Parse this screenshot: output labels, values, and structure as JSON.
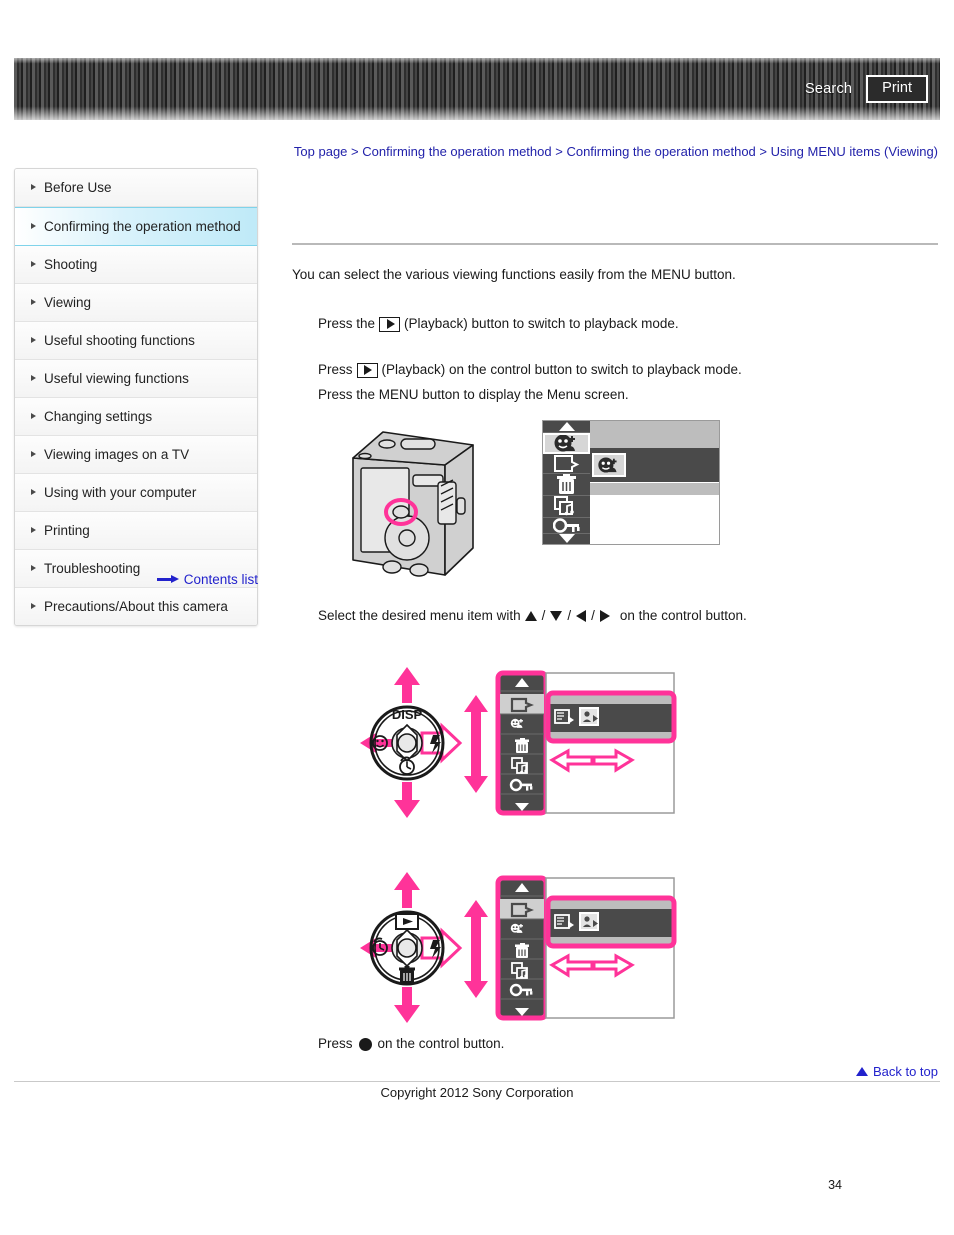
{
  "header": {
    "search_label": "Search",
    "print_label": "Print"
  },
  "breadcrumb": {
    "items": [
      "Top page",
      "Confirming the operation method",
      "Confirming the operation method",
      "Using MENU items (Viewing)"
    ],
    "separator": ">"
  },
  "sidebar": {
    "items": [
      {
        "label": "Before Use",
        "active": false
      },
      {
        "label": "Confirming the operation method",
        "active": true
      },
      {
        "label": "Shooting",
        "active": false
      },
      {
        "label": "Viewing",
        "active": false
      },
      {
        "label": "Useful shooting functions",
        "active": false
      },
      {
        "label": "Useful viewing functions",
        "active": false
      },
      {
        "label": "Changing settings",
        "active": false
      },
      {
        "label": "Viewing images on a TV",
        "active": false
      },
      {
        "label": "Using with your computer",
        "active": false
      },
      {
        "label": "Printing",
        "active": false
      },
      {
        "label": "Troubleshooting",
        "active": false
      },
      {
        "label": "Precautions/About this camera",
        "active": false
      }
    ],
    "contents_list_label": "Contents list"
  },
  "main": {
    "intro": "You can select the various viewing functions easily from the MENU button.",
    "step1_pre": "Press the",
    "step1_post": "(Playback) button to switch to playback mode.",
    "step2_pre": "Press",
    "step2_post": "(Playback) on the control button to switch to playback mode.",
    "step3": "Press the MENU button to display the Menu screen.",
    "step4_pre": "Select the desired menu item with",
    "step4_post": "on the control button.",
    "step5_pre": "Press",
    "step5_post": "on the control button.",
    "dial_label_disp": "DISP"
  },
  "footer": {
    "back_to_top_label": "Back to top",
    "copyright": "Copyright 2012 Sony Corporation",
    "page_number": "34"
  },
  "colors": {
    "link": "#2222cc",
    "breadcrumb": "#2222aa",
    "highlight_pink": "#ff3399",
    "sidebar_active": "#bfeaf8",
    "header_dark": "#3a3a3a"
  },
  "menu_icons": [
    "scroll-up-icon",
    "face-registration-icon",
    "retouch-icon",
    "delete-icon",
    "slideshow-icon",
    "protect-icon",
    "scroll-down-icon"
  ],
  "option_icons": [
    "view-mode-icon",
    "portrait-view-icon"
  ]
}
